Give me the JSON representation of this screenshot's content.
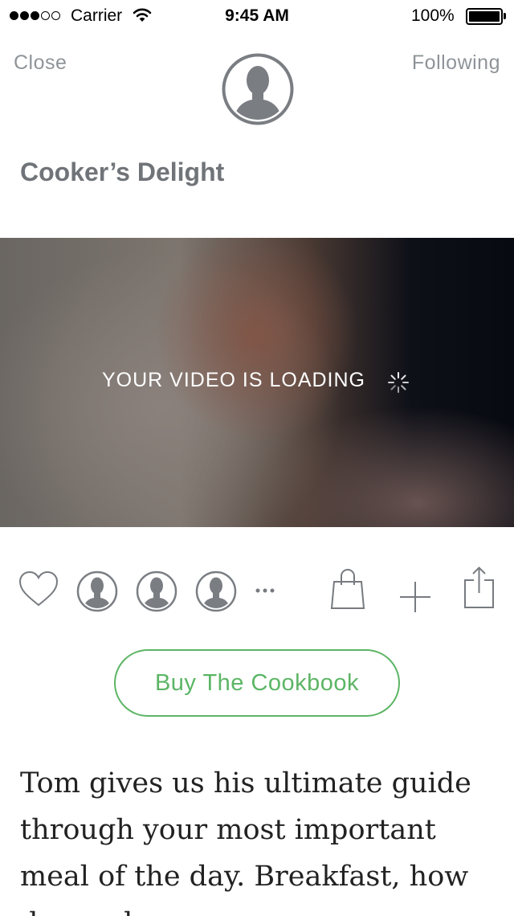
{
  "status_bar": {
    "carrier": "Carrier",
    "time": "9:45 AM",
    "battery": "100%"
  },
  "nav": {
    "close_label": "Close",
    "following_label": "Following"
  },
  "title": "Cooker’s Delight",
  "video": {
    "loading_text": "YOUR VIDEO IS LOADING"
  },
  "buy_button": "Buy The Cookbook",
  "description": "Tom gives us his ultimate guide through your most important meal of the day. Breakfast, how do you l",
  "colors": {
    "accent_green": "#5cb565",
    "nav_gray": "#8f9499",
    "icon_gray": "#777b80"
  }
}
